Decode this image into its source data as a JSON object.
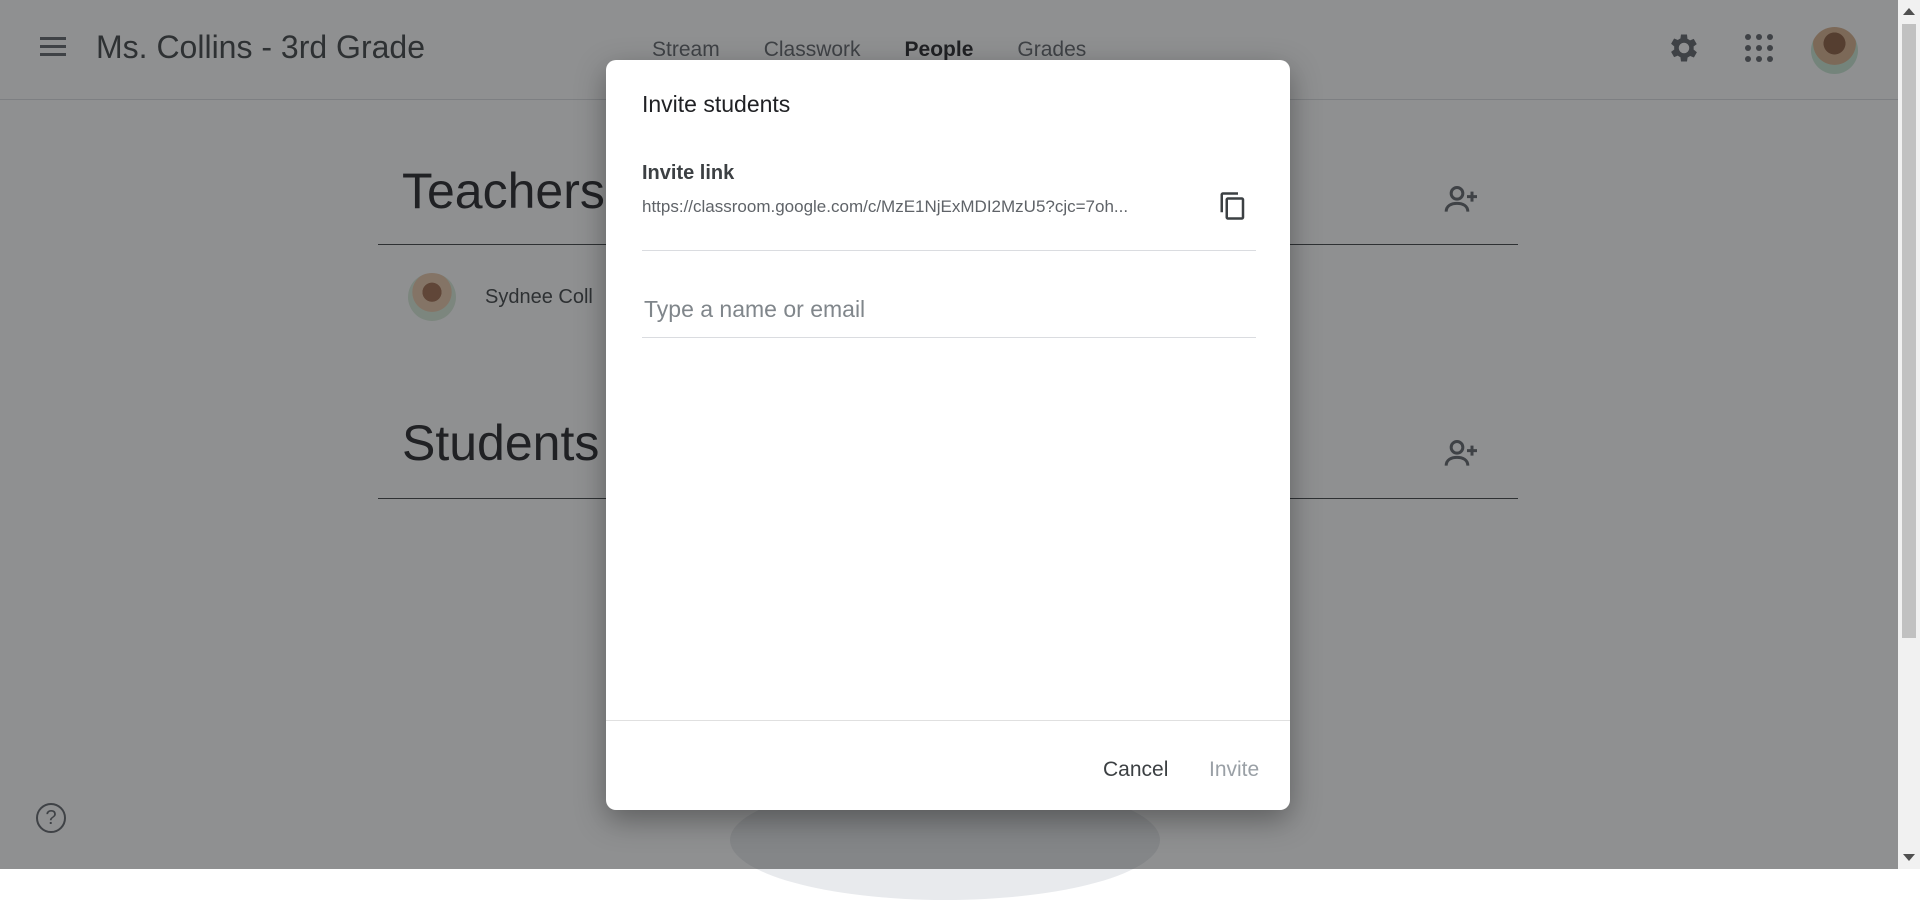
{
  "header": {
    "class_title": "Ms. Collins - 3rd Grade",
    "tabs": [
      {
        "label": "Stream"
      },
      {
        "label": "Classwork"
      },
      {
        "label": "People",
        "active": true
      },
      {
        "label": "Grades"
      }
    ],
    "icons": [
      "menu-icon",
      "settings-gear-icon",
      "apps-grid-icon",
      "account-avatar"
    ]
  },
  "people": {
    "teachers_title": "Teachers",
    "teacher_name": "Sydnee Coll",
    "students_title": "Students"
  },
  "help": {
    "glyph": "?"
  },
  "dialog": {
    "title": "Invite students",
    "invite_link_label": "Invite link",
    "invite_link_url": "https://classroom.google.com/c/MzE1NjExMDI2MzU5?cjc=7oh...",
    "name_placeholder": "Type a name or email",
    "cancel_label": "Cancel",
    "invite_label": "Invite"
  },
  "colors": {
    "scrim": "#202124",
    "text_primary": "#202124",
    "text_secondary": "#5f6368",
    "disabled": "#9aa0a6"
  }
}
